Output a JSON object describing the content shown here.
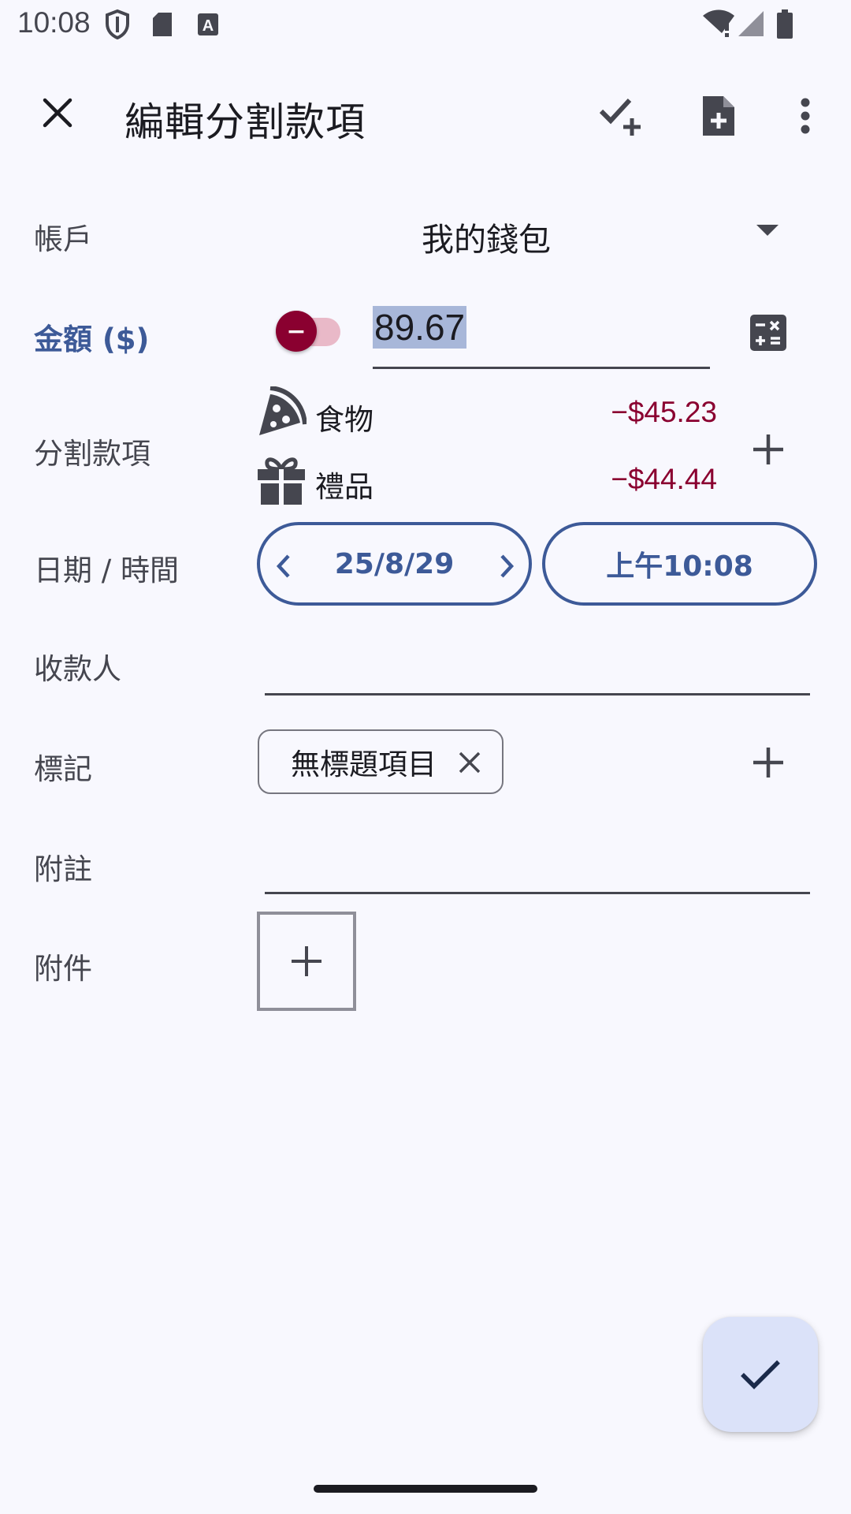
{
  "status_bar": {
    "time": "10:08",
    "icons": [
      "shield-icon",
      "sd-card-icon",
      "keyboard-a-icon",
      "wifi-alert-icon",
      "signal-icon",
      "battery-icon"
    ]
  },
  "app_bar": {
    "title": "編輯分割款項",
    "actions": [
      "check-add-icon",
      "note-add-icon",
      "more-vert-icon"
    ]
  },
  "account": {
    "label": "帳戶",
    "value": "我的錢包"
  },
  "amount": {
    "label": "金額 ($)",
    "sign": "−",
    "value": "89.67"
  },
  "splits": {
    "label": "分割款項",
    "items": [
      {
        "name": "食物",
        "amount": "−$45.23",
        "icon": "pizza-icon"
      },
      {
        "name": "禮品",
        "amount": "−$44.44",
        "icon": "gift-icon"
      }
    ]
  },
  "datetime": {
    "label": "日期 / 時間",
    "date": "25/8/29",
    "time": "上午10:08"
  },
  "payee": {
    "label": "收款人",
    "value": ""
  },
  "tags": {
    "label": "標記",
    "chips": [
      "無標題項目"
    ]
  },
  "notes": {
    "label": "附註",
    "value": ""
  },
  "attachments": {
    "label": "附件"
  },
  "colors": {
    "primary": "#3d5a98",
    "negative": "#8a0030",
    "background": "#f8f8fe",
    "fab": "#dbe2f9"
  }
}
